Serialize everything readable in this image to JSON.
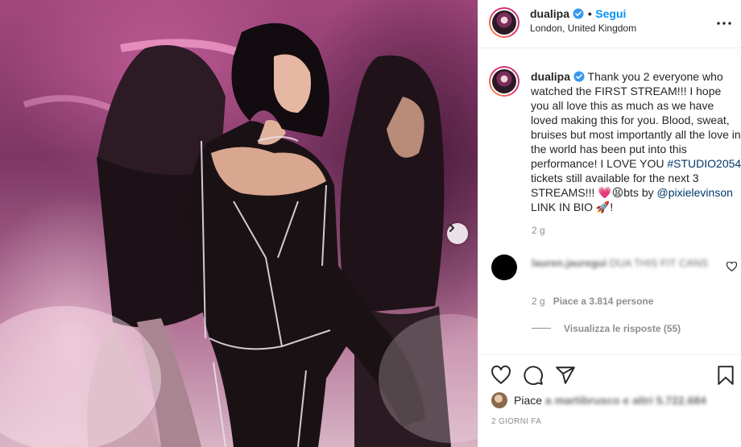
{
  "post": {
    "photo_alt": "Performer on stage in a sheer black sparkling catsuit",
    "next_button": "›"
  },
  "header": {
    "username": "dualipa",
    "separator": "•",
    "follow_label": "Segui",
    "location": "London, United Kingdom",
    "more_icon": "more-options-icon"
  },
  "caption": {
    "username": "dualipa",
    "text_part1": "Thank you 2 everyone who watched the FIRST STREAM!!! I hope you all love this as much as we have loved making this for you. Blood, sweat, bruises but most importantly all the love in the world has been put into this performance! I LOVE YOU ",
    "hashtag": "#STUDIO2054",
    "text_part2": " tickets still available for the next 3 STREAMS!!! 💗😫bts by ",
    "mention": "@pixielevinson",
    "text_part3": " LINK IN BIO 🚀!",
    "time": "2 g"
  },
  "comment": {
    "username": "lauren.jauregui",
    "text": "DUA THIS FIT CANS",
    "time": "2 g",
    "likes": "Piace a 3.814 persone",
    "view_replies": "Visualizza le risposte (55)"
  },
  "actions": {
    "like_icon": "heart-icon",
    "comment_icon": "comment-icon",
    "share_icon": "share-icon",
    "save_icon": "bookmark-icon"
  },
  "likes": {
    "prefix": "Piace",
    "rest": "a martibrusco e altri 5.722.684"
  },
  "date": "2 GIORNI FA",
  "colors": {
    "link_blue": "#0095f6",
    "hashtag_blue": "#00376b",
    "muted": "#8e8e8e",
    "text": "#262626"
  }
}
